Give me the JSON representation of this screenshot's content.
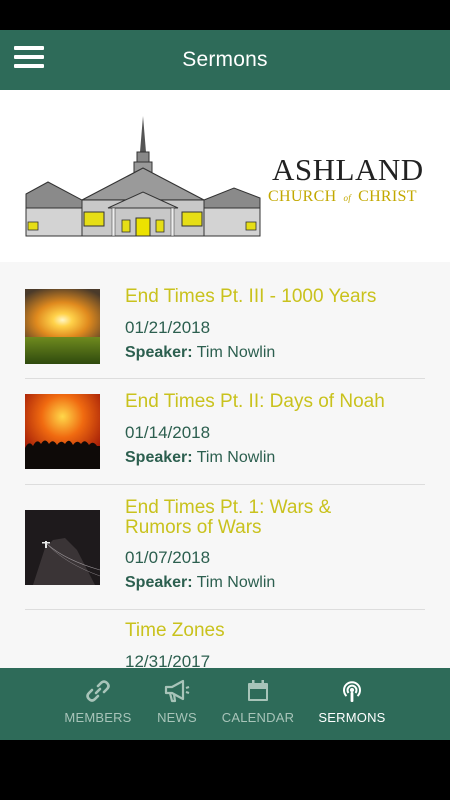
{
  "app_bar": {
    "title": "Sermons",
    "menu_icon": "hamburger-menu-icon"
  },
  "brand": {
    "name": "ASHLAND",
    "sub_left": "CHURCH",
    "sub_of": "of",
    "sub_right": "CHRIST"
  },
  "sermons": [
    {
      "title": "End Times Pt. III - 1000 Years",
      "date": "01/21/2018",
      "speaker_label": "Speaker:",
      "speaker": "Tim Nowlin",
      "thumbnail": "sunrise-field-image"
    },
    {
      "title": "End Times Pt. II: Days of Noah",
      "date": "01/14/2018",
      "speaker_label": "Speaker:",
      "speaker": "Tim Nowlin",
      "thumbnail": "crowd-fire-sky-image"
    },
    {
      "title": "End Times Pt. 1: Wars & Rumors of Wars",
      "date": "01/07/2018",
      "speaker_label": "Speaker:",
      "speaker": "Tim Nowlin",
      "thumbnail": "figure-on-hill-image"
    },
    {
      "title": "Time Zones",
      "date": "12/31/2017"
    }
  ],
  "tabs": [
    {
      "label": "MEMBERS",
      "icon": "link-icon",
      "active": false
    },
    {
      "label": "NEWS",
      "icon": "megaphone-icon",
      "active": false
    },
    {
      "label": "CALENDAR",
      "icon": "calendar-icon",
      "active": false
    },
    {
      "label": "SERMONS",
      "icon": "podcast-icon",
      "active": true
    }
  ],
  "colors": {
    "primary": "#2e6b59",
    "title_accent": "#c9c21d",
    "text_green": "#2c5f4f",
    "brand_gold": "#c2a800"
  }
}
